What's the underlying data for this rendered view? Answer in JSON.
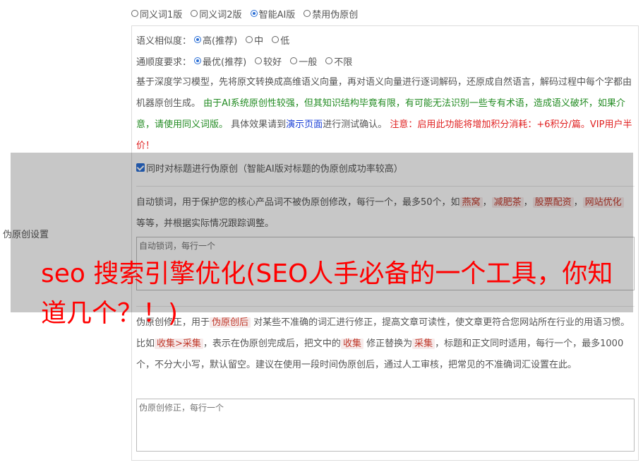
{
  "side_label": "伪原创设置",
  "versions": [
    {
      "label": "同义词1版",
      "checked": false
    },
    {
      "label": "同义词2版",
      "checked": false
    },
    {
      "label": "智能AI版",
      "checked": true
    },
    {
      "label": "禁用伪原创",
      "checked": false
    }
  ],
  "similarity": {
    "label": "语义相似度：",
    "options": [
      {
        "label": "高(推荐)",
        "checked": true
      },
      {
        "label": "中",
        "checked": false
      },
      {
        "label": "低",
        "checked": false
      }
    ]
  },
  "fluency": {
    "label": "通顺度要求：",
    "options": [
      {
        "label": "最优(推荐)",
        "checked": true
      },
      {
        "label": "较好",
        "checked": false
      },
      {
        "label": "一般",
        "checked": false
      },
      {
        "label": "不限",
        "checked": false
      }
    ]
  },
  "description": {
    "part1": "基于深度学习模型，先将原文转换成高维语义向量，再对语义向量进行逐词解码，还原成自然语言，解码过程中每个字都由机器原创生成。",
    "green": "由于AI系统原创性较强，但其知识结构毕竟有限，有可能无法识别一些专有术语，造成语义破坏，如果介意，请使用同义词版。",
    "part2": "具体效果请到",
    "link": "演示页面",
    "part3": "进行测试确认。",
    "red": "注意：启用此功能将增加积分消耗：+6积分/篇。VIP用户半价！"
  },
  "title_checkbox": {
    "label": "同时对标题进行伪原创（智能AI版对标题的伪原创成功率较高）",
    "checked": true
  },
  "lock_words": {
    "text1": "自动锁词，用于保护您的核心产品词不被伪原创修改，每行一个，最多50个，如",
    "examples": [
      "燕窝",
      "减肥茶",
      "股票配资",
      "网站优化"
    ],
    "sep": "，",
    "text2": "等等，并根据实际情况跟踪调整。",
    "placeholder": "自动锁词，每行一个"
  },
  "correction": {
    "text1": "伪原创修正，用于",
    "tag1": "伪原创后",
    "text2": "对某些不准确的词汇进行修正，提高文章可读性，使文章更符合您网站所在行业的用语习惯。比如",
    "tag2": "收集>采集",
    "text3": "，表示在伪原创完成后，把文中的",
    "tag3": "收集",
    "text4": "修正替换为",
    "tag4": "采集",
    "text5": "，标题和正文同时适用，每行一个，最多1000个，不分大小写，默认留空。建议在使用一段时间伪原创后，通过人工审核，把常见的不准确词汇设置在此。",
    "placeholder": "伪原创修正，每行一个"
  },
  "headline": "seo 搜索引擎优化(SEO人手必备的一个工具，你知道几个？！)"
}
